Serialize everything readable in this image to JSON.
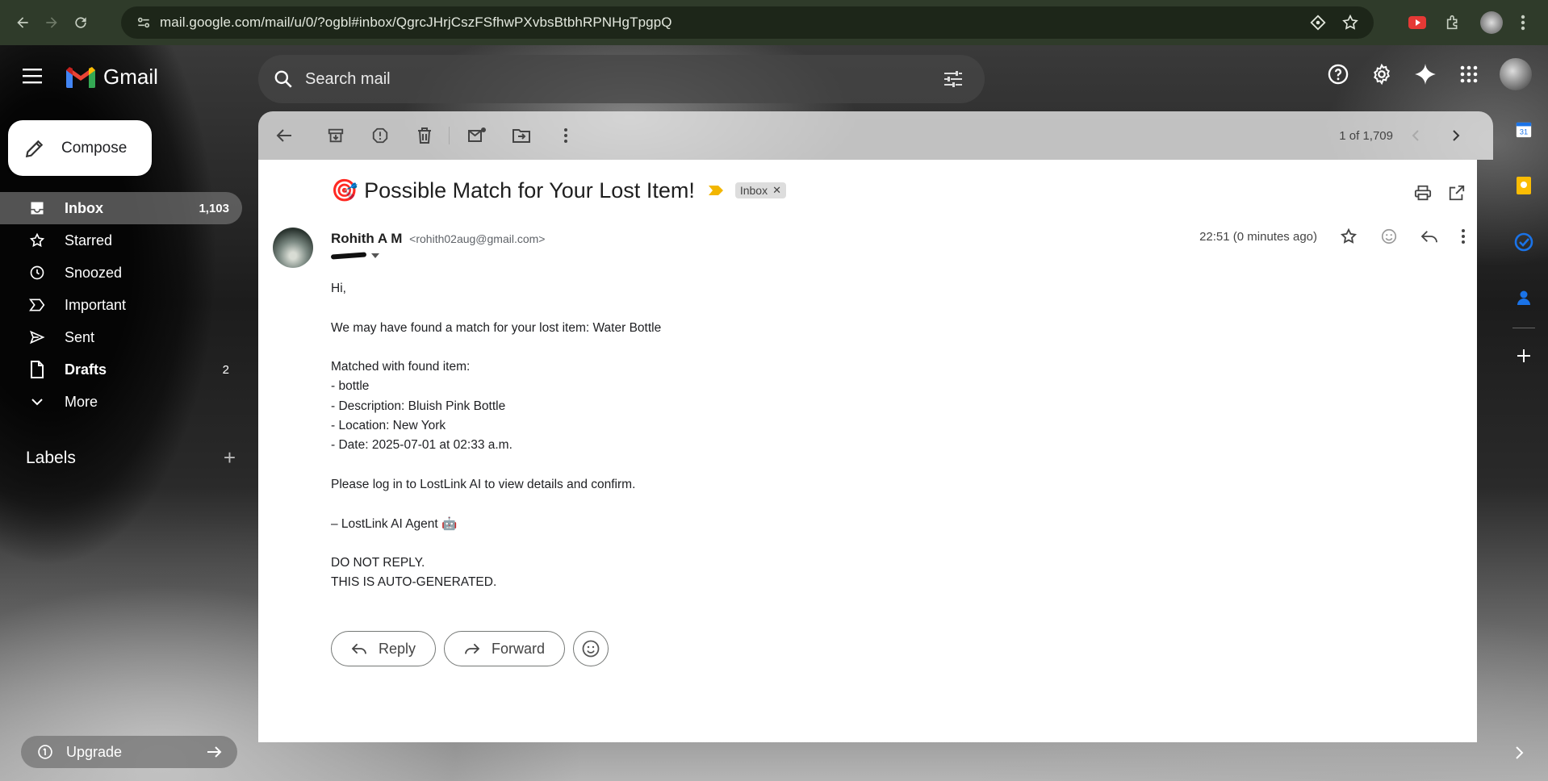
{
  "browser": {
    "url": "mail.google.com/mail/u/0/?ogbl#inbox/QgrcJHrjCszFSfhwPXvbsBtbhRPNHgTpgpQ"
  },
  "app": {
    "name": "Gmail"
  },
  "search": {
    "placeholder": "Search mail"
  },
  "sidebar": {
    "compose_label": "Compose",
    "items": [
      {
        "label": "Inbox",
        "count": "1,103",
        "icon": "inbox-icon"
      },
      {
        "label": "Starred",
        "count": "",
        "icon": "star-icon"
      },
      {
        "label": "Snoozed",
        "count": "",
        "icon": "clock-icon"
      },
      {
        "label": "Important",
        "count": "",
        "icon": "important-icon"
      },
      {
        "label": "Sent",
        "count": "",
        "icon": "send-icon"
      },
      {
        "label": "Drafts",
        "count": "2",
        "icon": "draft-icon"
      },
      {
        "label": "More",
        "count": "",
        "icon": "chevron-down-icon"
      }
    ],
    "labels_heading": "Labels",
    "upgrade_label": "Upgrade"
  },
  "toolbar": {
    "pager_text": "1 of 1,709"
  },
  "email": {
    "subject": "🎯 Possible Match for Your Lost Item!",
    "label_chip": "Inbox",
    "sender_name": "Rohith A M",
    "sender_email": "<rohith02aug@gmail.com>",
    "time": "22:51 (0 minutes ago)",
    "body": [
      "Hi,",
      "",
      "We may have found a match for your lost item: Water Bottle",
      "",
      "Matched with found item:",
      "- bottle",
      "- Description: Bluish Pink Bottle",
      "- Location: New York",
      "- Date: 2025-07-01 at 02:33 a.m.",
      "",
      "Please log in to LostLink AI to view details and confirm.",
      "",
      "– LostLink AI Agent 🤖",
      "",
      "DO NOT REPLY.",
      "THIS IS AUTO-GENERATED."
    ],
    "reply_label": "Reply",
    "forward_label": "Forward"
  },
  "colors": {
    "chrome_bg": "#2f3b2a",
    "accent_important": "#f2b600",
    "calendar_blue": "#1a73e8",
    "keep_yellow": "#fbbc04"
  }
}
